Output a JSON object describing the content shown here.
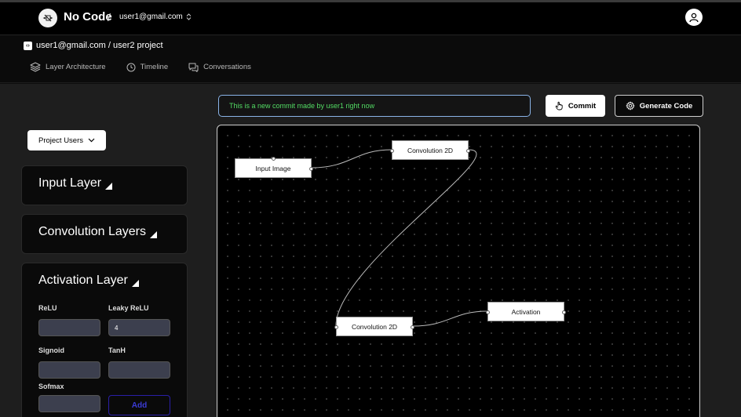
{
  "header": {
    "brand": "No Code",
    "separator": "/",
    "account": "user1@gmail.com",
    "icons": {
      "logo": "no-code-logo-icon",
      "account_toggle": "chevron-updown-icon",
      "profile": "user-avatar-icon"
    }
  },
  "project": {
    "icon": "code-bracket-icon",
    "path": "user1@gmail.com / user2 project"
  },
  "tabs": [
    {
      "label": "Layer Architecture",
      "icon": "layers-icon"
    },
    {
      "label": "Timeline",
      "icon": "clock-icon"
    },
    {
      "label": "Conversations",
      "icon": "chat-icon"
    }
  ],
  "toolbar": {
    "commit_message": "This is a new commit made by user1 right now",
    "commit_label": "Commit",
    "generate_label": "Generate Code",
    "colors": {
      "commit_text": "#53dc64",
      "input_border": "#8ab4e8"
    }
  },
  "sidebar": {
    "users_button": "Project Users",
    "panels": [
      {
        "title": "Input Layer"
      },
      {
        "title": "Convolution Layers"
      },
      {
        "title": "Activation Layer"
      }
    ],
    "activation": {
      "relu_label": "ReLU",
      "relu_value": "",
      "leaky_label": "Leaky ReLU",
      "leaky_value": "4",
      "sigmoid_label": "Signoid",
      "sigmoid_value": "",
      "tanh_label": "TanH",
      "tanh_value": "",
      "softmax_label": "Sofmax",
      "softmax_value": "",
      "add_label": "Add",
      "add_color": "#3b3bd6"
    }
  },
  "canvas": {
    "nodes": [
      {
        "label": "Input Image"
      },
      {
        "label": "Convolution 2D"
      },
      {
        "label": "Convolution 2D"
      },
      {
        "label": "Activation"
      }
    ]
  }
}
